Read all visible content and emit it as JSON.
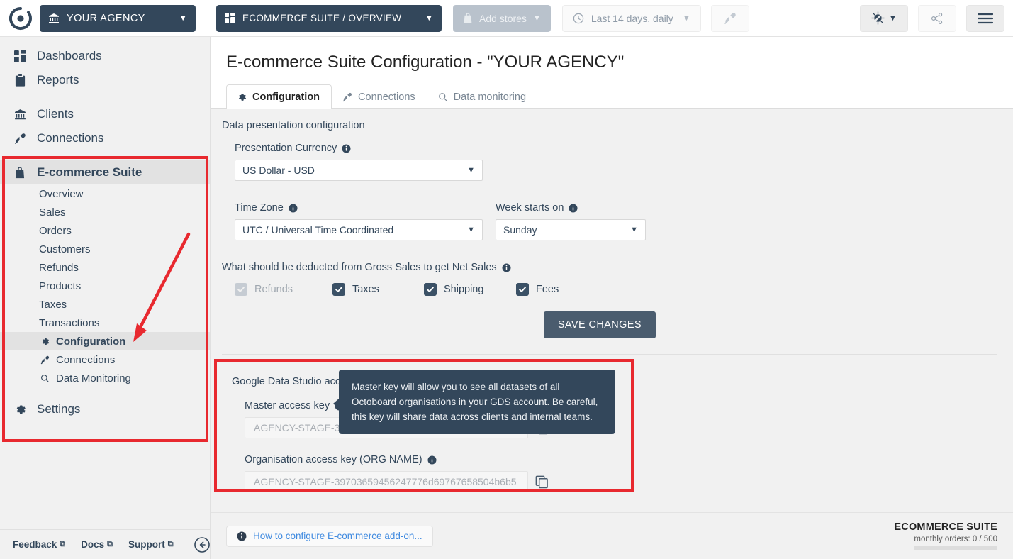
{
  "topbar": {
    "logo_icon": "octoboard-logo-icon",
    "agency": {
      "icon": "bank-icon",
      "label": "YOUR AGENCY",
      "caret": "▼"
    },
    "suite": {
      "icon": "grid-icon",
      "label": "ECOMMERCE SUITE / OVERVIEW",
      "caret": "▼"
    },
    "add_stores": {
      "icon": "bag-icon",
      "label": "Add stores",
      "caret": "▼"
    },
    "date_range": {
      "icon": "clock-icon",
      "label": "Last 14 days, daily",
      "caret": "▼"
    },
    "plug_button": {
      "icon": "plug-icon"
    },
    "theme_button": {
      "icon": "contrast-icon",
      "caret": "▼"
    },
    "share_button": {
      "icon": "share-icon"
    },
    "menu_button": {
      "icon": "hamburger-icon"
    }
  },
  "sidebar": {
    "main_items": [
      {
        "label": "Dashboards",
        "icon": "grid-icon"
      },
      {
        "label": "Reports",
        "icon": "clipboard-icon"
      },
      {
        "label": "Clients",
        "icon": "bank-icon"
      },
      {
        "label": "Connections",
        "icon": "plug-icon"
      }
    ],
    "suite": {
      "label": "E-commerce Suite",
      "icon": "bag-icon"
    },
    "sub_items": [
      {
        "label": "Overview",
        "icon": ""
      },
      {
        "label": "Sales",
        "icon": ""
      },
      {
        "label": "Orders",
        "icon": ""
      },
      {
        "label": "Customers",
        "icon": ""
      },
      {
        "label": "Refunds",
        "icon": ""
      },
      {
        "label": "Products",
        "icon": ""
      },
      {
        "label": "Taxes",
        "icon": ""
      },
      {
        "label": "Transactions",
        "icon": ""
      },
      {
        "label": "Configuration",
        "icon": "gear-icon"
      },
      {
        "label": "Connections",
        "icon": "plug-icon"
      },
      {
        "label": "Data Monitoring",
        "icon": "search-icon"
      }
    ],
    "settings": {
      "label": "Settings",
      "icon": "gear-icon"
    },
    "footer": {
      "feedback": "Feedback",
      "docs": "Docs",
      "support": "Support",
      "external_glyph": "⧉",
      "collapse_icon": "collapse-left-icon"
    },
    "annotation_color": "#e8292f"
  },
  "main": {
    "page_title": "E-commerce Suite Configuration - \"YOUR AGENCY\"",
    "tabs": [
      {
        "label": "Configuration",
        "icon": "gear-icon",
        "active": true
      },
      {
        "label": "Connections",
        "icon": "plug-icon",
        "active": false
      },
      {
        "label": "Data monitoring",
        "icon": "search-icon",
        "active": false
      }
    ],
    "section_label": "Data presentation configuration",
    "presentation_currency": {
      "label": "Presentation Currency",
      "info_icon": "info-icon",
      "value": "US Dollar - USD",
      "caret": "▼"
    },
    "time_zone": {
      "label": "Time Zone",
      "info_icon": "info-icon",
      "value": "UTC / Universal Time Coordinated",
      "caret": "▼"
    },
    "week_starts_on": {
      "label": "Week starts on",
      "info_icon": "info-icon",
      "value": "Sunday",
      "caret": "▼"
    },
    "deduction": {
      "label": "What should be deducted from Gross Sales to get Net Sales",
      "info_icon": "info-icon",
      "checkboxes": [
        {
          "label": "Refunds",
          "checked": true,
          "disabled": true
        },
        {
          "label": "Taxes",
          "checked": true,
          "disabled": false
        },
        {
          "label": "Shipping",
          "checked": true,
          "disabled": false
        },
        {
          "label": "Fees",
          "checked": true,
          "disabled": false
        }
      ]
    },
    "save_label": "SAVE CHANGES",
    "gds": {
      "title": "Google Data Studio access keys",
      "info_icon": "info-icon",
      "master": {
        "label": "Master access key",
        "info_icon": "info-icon",
        "value": "AGENCY-STAGE-3970",
        "copy_icon": "copy-icon"
      },
      "org": {
        "label": "Organisation access key (ORG NAME)",
        "info_icon": "info-icon",
        "value": "AGENCY-STAGE-39703659456247776d69767658504b6b5",
        "copy_icon": "copy-icon"
      },
      "tooltip": "Master key will allow you to see all datasets of all Octoboard organisations in your GDS account. Be careful, this key will share data across clients and internal teams."
    },
    "footer": {
      "howto_label": "How to configure E-commerce add-on...",
      "howto_icon": "info-icon",
      "usage_title": "ECOMMERCE SUITE",
      "usage_sub": "monthly orders: 0 / 500"
    }
  },
  "colors": {
    "brand_dark": "#33475b",
    "annotation_red": "#e8292f",
    "link_blue": "#3f8ae0",
    "page_bg": "#f1f1f1"
  }
}
